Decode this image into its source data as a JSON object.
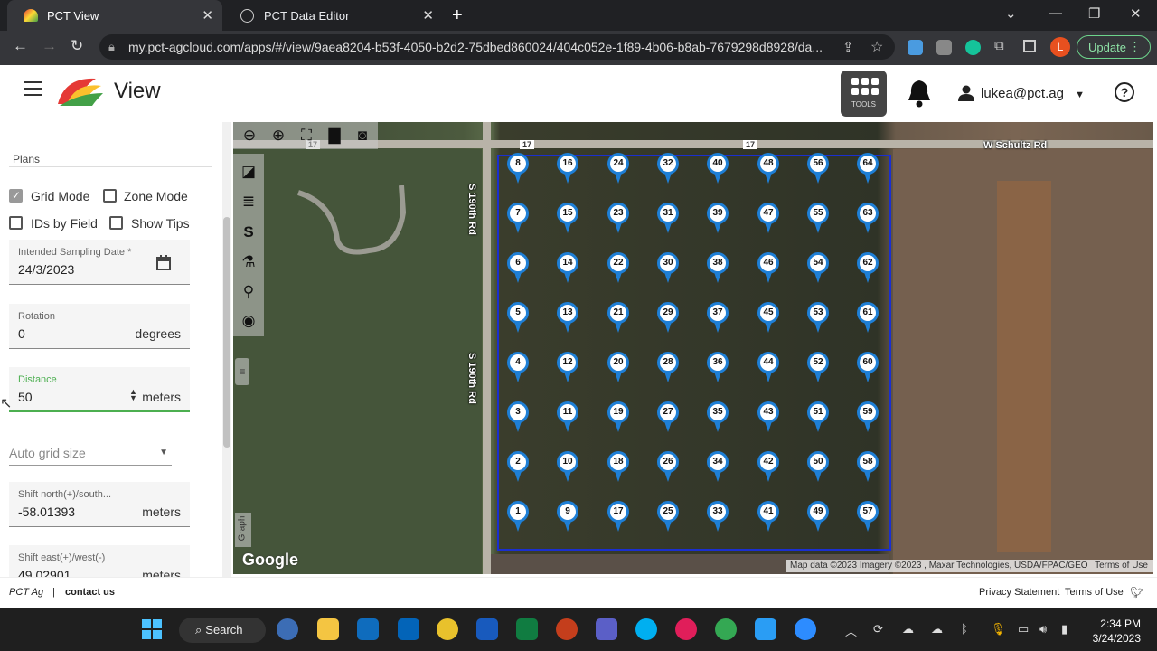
{
  "browser": {
    "tabs": [
      {
        "title": "PCT View",
        "active": true
      },
      {
        "title": "PCT Data Editor",
        "active": false
      }
    ],
    "url": "my.pct-agcloud.com/apps/#/view/9aea8204-b53f-4050-b2d2-75dbed860024/404c052e-1f89-4b06-b8ab-7679298d8928/da...",
    "update_label": "Update",
    "profile_initial": "L"
  },
  "header": {
    "title": "View",
    "tools_label": "TOOLS",
    "user": "lukea@pct.ag",
    "help": "?"
  },
  "panel": {
    "section": "Plans",
    "checkboxes": [
      {
        "label": "Grid Mode",
        "checked": true
      },
      {
        "label": "Zone Mode",
        "checked": false
      },
      {
        "label": "IDs by Field",
        "checked": false
      },
      {
        "label": "Show Tips",
        "checked": false
      }
    ],
    "sampling_date": {
      "label": "Intended Sampling Date *",
      "value": "24/3/2023"
    },
    "rotation": {
      "label": "Rotation",
      "value": "0",
      "unit": "degrees"
    },
    "distance": {
      "label": "Distance",
      "value": "50",
      "unit": "meters"
    },
    "grid_size": {
      "placeholder": "Auto grid size"
    },
    "shift_north": {
      "label": "Shift north(+)/south...",
      "value": "-58.01393",
      "unit": "meters"
    },
    "shift_east": {
      "label": "Shift east(+)/west(-)",
      "value": "49.02901",
      "unit": "meters"
    }
  },
  "map": {
    "road_top": "W Schultz Rd",
    "road_left": "S 190th Rd",
    "route_badge": "17",
    "graph_tab": "Graph",
    "google": "Google",
    "attribution": "Map data ©2023 Imagery ©2023 , Maxar Technologies, USDA/FPAC/GEO",
    "terms": "Terms of Use",
    "markers": [
      [
        8,
        16,
        24,
        32,
        40,
        48,
        56,
        64
      ],
      [
        7,
        15,
        23,
        31,
        39,
        47,
        55,
        63
      ],
      [
        6,
        14,
        22,
        30,
        38,
        46,
        54,
        62
      ],
      [
        5,
        13,
        21,
        29,
        37,
        45,
        53,
        61
      ],
      [
        4,
        12,
        20,
        28,
        36,
        44,
        52,
        60
      ],
      [
        3,
        11,
        19,
        27,
        35,
        43,
        51,
        59
      ],
      [
        2,
        10,
        18,
        26,
        34,
        42,
        50,
        58
      ],
      [
        1,
        9,
        17,
        25,
        33,
        41,
        49,
        57
      ]
    ]
  },
  "footer": {
    "brand": "PCT Ag",
    "separator": "|",
    "contact": "contact us",
    "privacy": "Privacy Statement",
    "terms": "Terms of Use"
  },
  "taskbar": {
    "search": "Search",
    "time": "2:34 PM",
    "date": "3/24/2023"
  }
}
